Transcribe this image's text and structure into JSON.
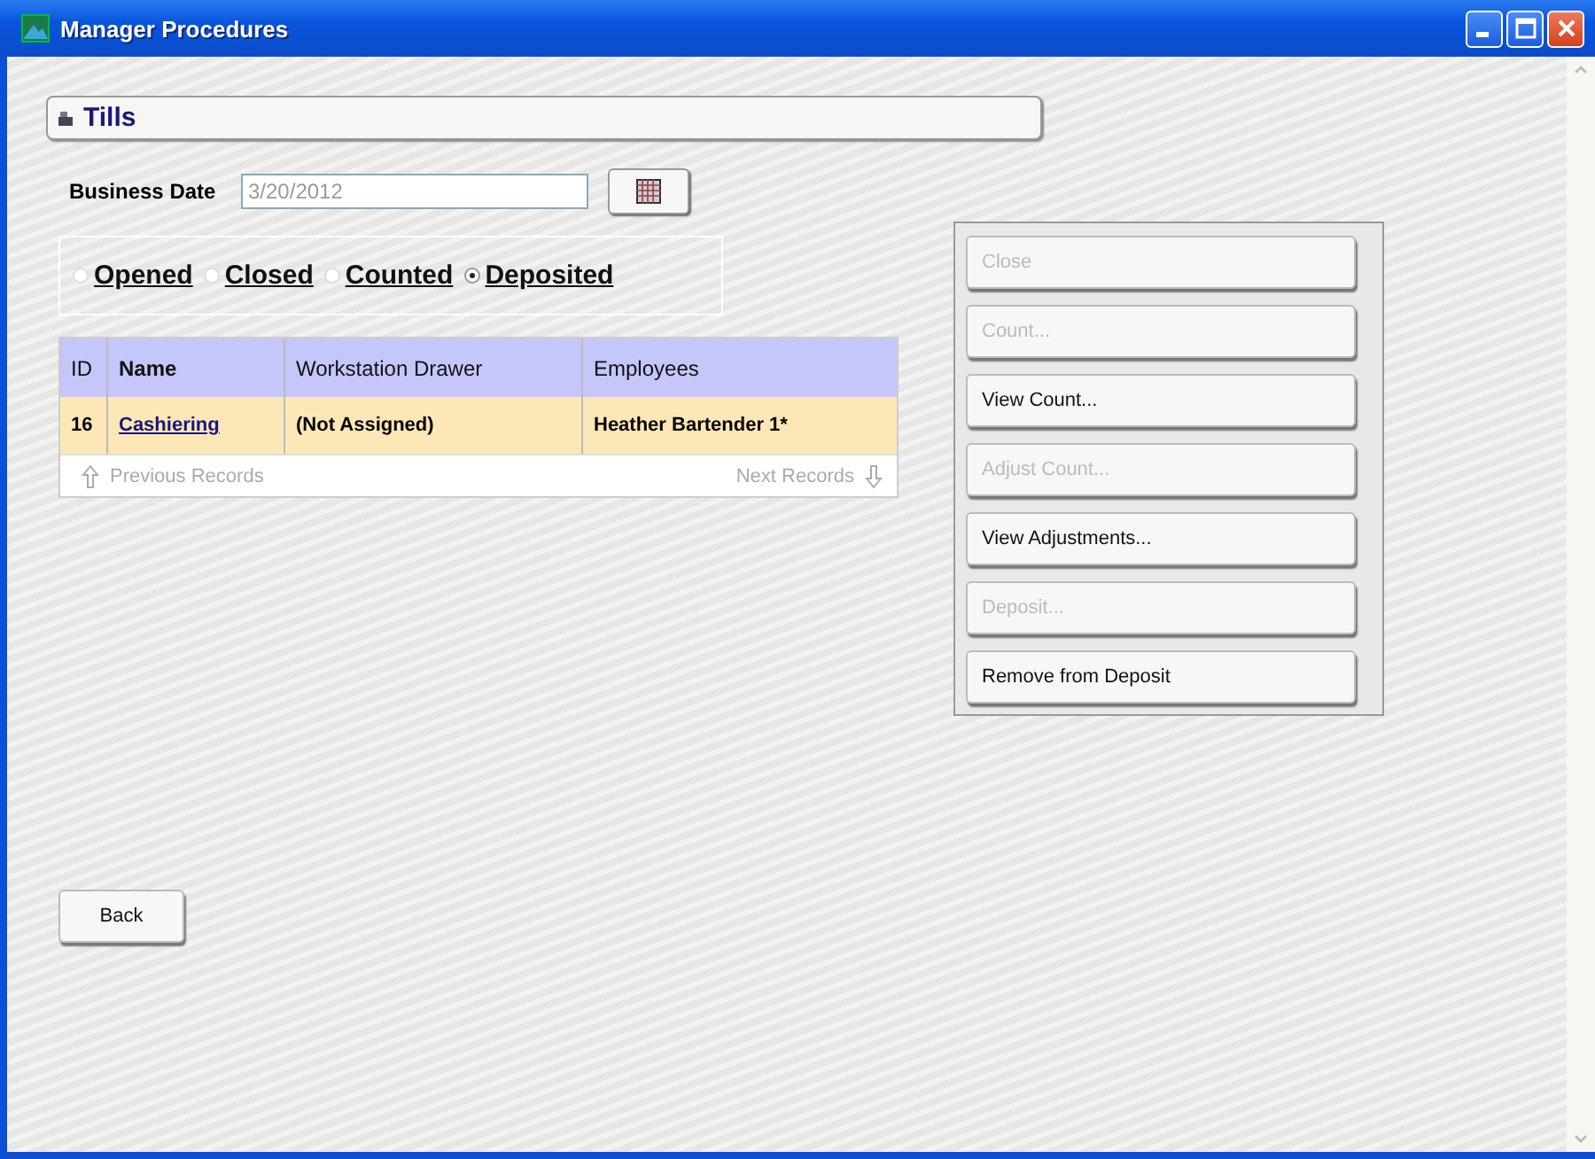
{
  "window": {
    "title": "Manager Procedures"
  },
  "section": {
    "title": "Tills"
  },
  "business_date": {
    "label": "Business Date",
    "value": "3/20/2012"
  },
  "filters": [
    {
      "label": "Opened",
      "selected": false
    },
    {
      "label": "Closed",
      "selected": false
    },
    {
      "label": "Counted",
      "selected": false
    },
    {
      "label": "Deposited",
      "selected": true
    }
  ],
  "table": {
    "columns": [
      "ID",
      "Name",
      "Workstation Drawer",
      "Employees"
    ],
    "rows": [
      {
        "id": "16",
        "name": "Cashiering",
        "drawer": "(Not Assigned)",
        "employees": "Heather Bartender 1*",
        "selected": true
      }
    ],
    "previous": "Previous Records",
    "next": "Next Records"
  },
  "actions": [
    {
      "label": "Close",
      "disabled": true
    },
    {
      "label": "Count...",
      "disabled": true
    },
    {
      "label": "View Count...",
      "disabled": false
    },
    {
      "label": "Adjust Count...",
      "disabled": true
    },
    {
      "label": "View Adjustments...",
      "disabled": false
    },
    {
      "label": "Deposit...",
      "disabled": true
    },
    {
      "label": "Remove from Deposit",
      "disabled": false
    }
  ],
  "back_button": "Back"
}
